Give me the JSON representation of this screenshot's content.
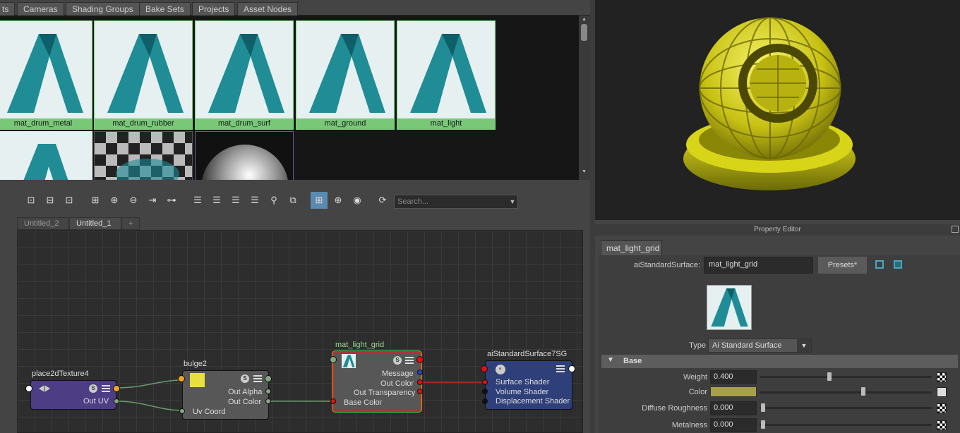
{
  "browser": {
    "tabs": [
      "ts",
      "Cameras",
      "Shading Groups",
      "Bake Sets",
      "Projects",
      "Asset Nodes"
    ],
    "swatches": [
      {
        "label": "mat_drum_metal"
      },
      {
        "label": "mat_drum_rubber"
      },
      {
        "label": "mat_drum_surf"
      },
      {
        "label": "mat_ground"
      },
      {
        "label": "mat_light"
      }
    ]
  },
  "graph_editor": {
    "search_placeholder": "Search...",
    "tabs": [
      "Untitled_2",
      "Untitled_1",
      "+"
    ],
    "nodes": {
      "place2d": {
        "title": "place2dTexture4",
        "port": "Out UV"
      },
      "bulge": {
        "title": "bulge2",
        "ports": [
          "Out Alpha",
          "Out Color",
          "Uv Coord"
        ]
      },
      "material": {
        "title": "mat_light_grid",
        "ports": [
          "Message",
          "Out Color",
          "Out Transparency",
          "Base Color"
        ]
      },
      "sg": {
        "title": "aiStandardSurface7SG",
        "ports": [
          "Surface Shader",
          "Volume Shader",
          "Displacement Shader"
        ]
      }
    }
  },
  "property_editor": {
    "title": "Property Editor",
    "tab": "mat_light_grid",
    "node_type_label": "aiStandardSurface:",
    "node_name": "mat_light_grid",
    "presets_label": "Presets*",
    "type_label": "Type",
    "type_value": "Ai Standard Surface",
    "section": "Base",
    "attrs": [
      {
        "label": "Weight",
        "value": "0.400",
        "level": 0.4
      },
      {
        "label": "Color",
        "value": "",
        "level": 0.6
      },
      {
        "label": "Diffuse Roughness",
        "value": "0.000",
        "level": 0
      },
      {
        "label": "Metalness",
        "value": "0.000",
        "level": 0
      }
    ]
  },
  "colors": {
    "swatch_label_bg": "#78c878",
    "color_swatch": "#a8a14a",
    "selected_border": "#e02020",
    "sg_node": "#2e3f7a",
    "place2d_node": "#4d3d84",
    "sphere_yellow": "#e6e21a"
  }
}
